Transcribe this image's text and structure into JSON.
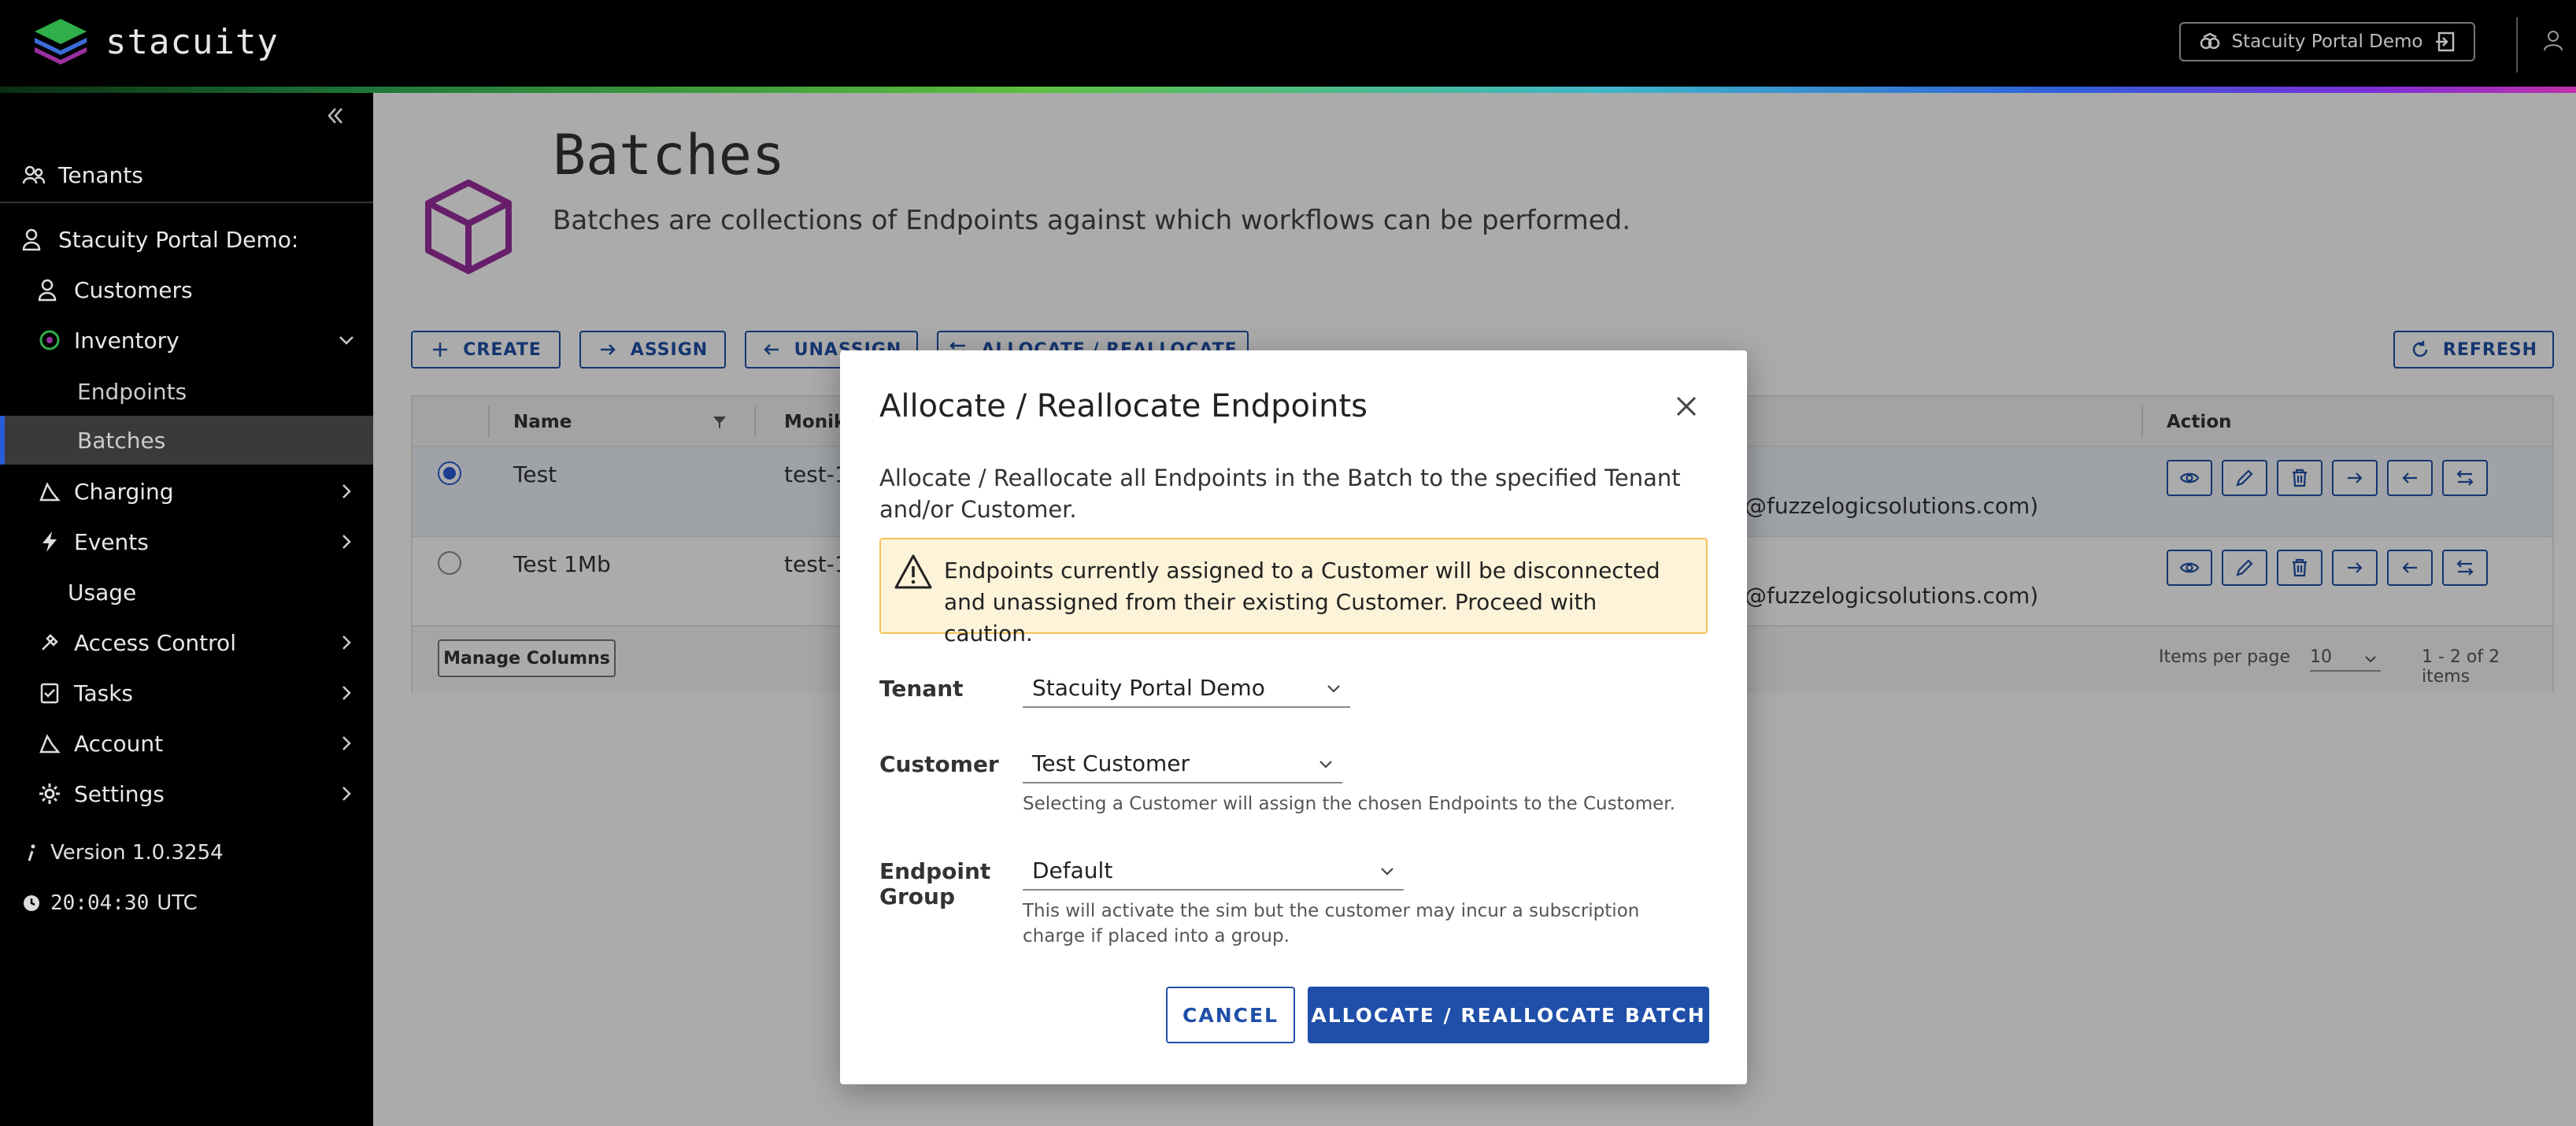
{
  "app": {
    "name": "stacuity",
    "tenant_button": "Stacuity Portal Demo"
  },
  "sidebar": {
    "tenants": "Tenants",
    "org": "Stacuity Portal Demo:",
    "items": [
      {
        "label": "Customers",
        "icon": "customers-icon"
      },
      {
        "label": "Inventory",
        "icon": "inventory-icon",
        "expanded": true
      },
      {
        "label": "Charging",
        "icon": "charging-icon"
      },
      {
        "label": "Events",
        "icon": "events-icon"
      },
      {
        "label": "Usage",
        "icon": "usage-icon"
      },
      {
        "label": "Access Control",
        "icon": "access-control-icon"
      },
      {
        "label": "Tasks",
        "icon": "tasks-icon"
      },
      {
        "label": "Account",
        "icon": "account-icon"
      },
      {
        "label": "Settings",
        "icon": "settings-icon"
      }
    ],
    "inventory_children": [
      "Endpoints",
      "Batches"
    ],
    "active_child": "Batches",
    "version": "Version 1.0.3254",
    "clock": "20:04:30",
    "clock_zone": "UTC"
  },
  "page": {
    "title": "Batches",
    "subtitle": "Batches are collections of Endpoints against which workflows can be performed."
  },
  "toolbar": {
    "create": "CREATE",
    "assign": "ASSIGN",
    "unassign": "UNASSIGN",
    "allocate": "ALLOCATE / REALLOCATE",
    "refresh": "REFRESH"
  },
  "grid": {
    "columns": [
      "Name",
      "Monike",
      "Action"
    ],
    "rows": [
      {
        "name": "Test",
        "moniker": "test-1",
        "owner": "@fuzzelogicsolutions.com)",
        "selected": true
      },
      {
        "name": "Test 1Mb",
        "moniker": "test-1",
        "owner": "@fuzzelogicsolutions.com)",
        "selected": false
      }
    ],
    "manage_columns": "Manage Columns",
    "items_per_page_label": "Items per page",
    "items_per_page": "10",
    "range": "1 - 2 of 2 items"
  },
  "modal": {
    "title": "Allocate / Reallocate Endpoints",
    "description": "Allocate / Reallocate all Endpoints in the Batch to the specified Tenant and/or Customer.",
    "warning": "Endpoints currently assigned to a Customer will be disconnected and unassigned from their existing Customer. Proceed with caution.",
    "tenant_label": "Tenant",
    "tenant_value": "Stacuity Portal Demo",
    "customer_label": "Customer",
    "customer_value": "Test Customer",
    "customer_hint": "Selecting a Customer will assign the chosen Endpoints to the Customer.",
    "group_label": "Endpoint Group",
    "group_value": "Default",
    "group_hint": "This will activate the sim but the customer may incur a subscription charge if placed into a group.",
    "cancel": "CANCEL",
    "submit": "ALLOCATE / REALLOCATE BATCH"
  },
  "colors": {
    "primary": "#1f4fa8",
    "warning_bg": "#fdf3d9",
    "accent_purple": "#9b2fa0",
    "selected_radio": "#2a5bd7"
  }
}
